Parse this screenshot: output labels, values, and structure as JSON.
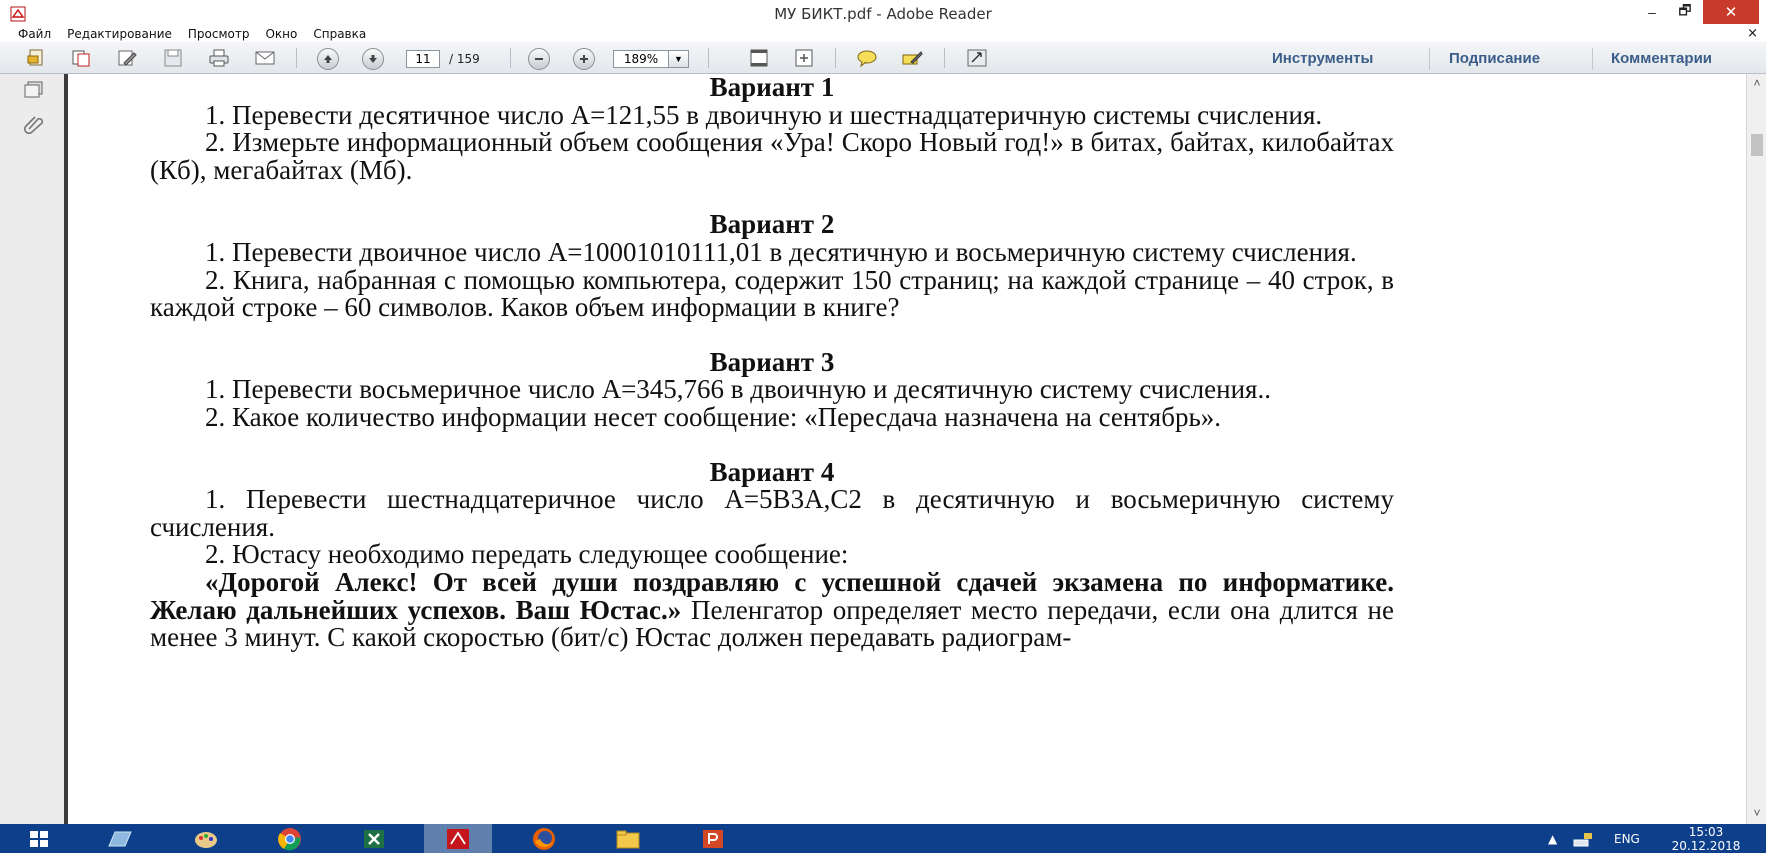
{
  "window": {
    "title": "МУ БИКТ.pdf - Adobe Reader",
    "minimize": "–",
    "maximize": "🗗",
    "close": "✕"
  },
  "menu": {
    "items": [
      "Файл",
      "Редактирование",
      "Просмотр",
      "Окно",
      "Справка"
    ],
    "close_doc": "×"
  },
  "toolbar": {
    "page_current": "11",
    "page_total": "/ 159",
    "zoom": "189%",
    "zoom_dropdown": "▼",
    "links": [
      "Инструменты",
      "Подписание",
      "Комментарии"
    ]
  },
  "document": {
    "v1_heading": "Вариант 1",
    "v1_p1": "1.  Перевести десятичное число A=121,55 в двоичную и шестнадцатеричную системы счисления.",
    "v1_p2": "2.  Измерьте информационный объем сообщения «Ура! Скоро Новый год!» в битах, байтах, килобайтах (Кб), мегабайтах (Мб).",
    "v2_heading": "Вариант 2",
    "v2_p1": "1.  Перевести двоичное число A=10001010111,01 в десятичную и восьмеричную систему счисления.",
    "v2_p2": "2.  Книга, набранная с помощью компьютера, содержит 150 страниц; на каждой странице – 40 строк, в каждой строке – 60 символов. Каков объем информации в книге?",
    "v3_heading": "Вариант 3",
    "v3_p1": "1.  Перевести восьмеричное число A=345,766 в двоичную и десятичную систему счисления..",
    "v3_p2": "2.  Какое количество информации несет сообщение: «Пересдача назначена на сентябрь».",
    "v4_heading": "Вариант 4",
    "v4_p1": "1.  Перевести шестнадцатеричное число A=5B3A,C2 в десятичную и восьмеричную систему счисления.",
    "v4_p2": "2.  Юстасу необходимо передать следующее сообщение:",
    "v4_p3_bold": "«Дорогой Алекс! От всей души поздравляю с успешной сдачей экзамена по информатике. Желаю дальнейших успехов. Ваш Юстас.»",
    "v4_p3_rest": " Пеленгатор определяет место передачи, если она длится не менее 3 минут. С какой скоростью (бит/с) Юстас должен передавать радиограм-"
  },
  "scrollbar": {
    "up": "˄",
    "down": "˅"
  },
  "taskbar": {
    "lang": "ENG",
    "time": "15:03",
    "date": "20.12.2018",
    "tray_up": "▲"
  }
}
